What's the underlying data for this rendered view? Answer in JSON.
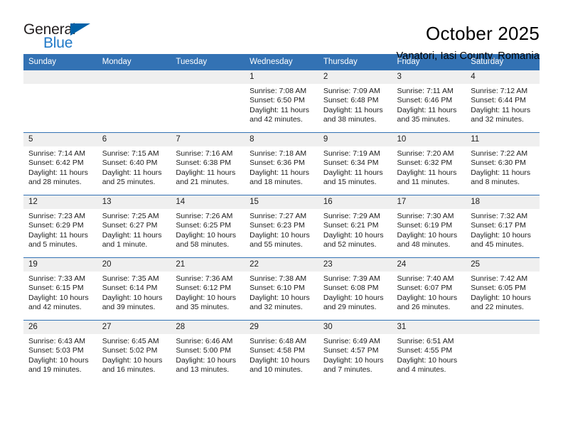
{
  "logo": {
    "word_top": "General",
    "word_bottom": "Blue",
    "triangle_color": "#0061a8",
    "blue_color": "#2079c7"
  },
  "header": {
    "month_title": "October 2025",
    "location": "Vanatori, Iasi County, Romania"
  },
  "theme": {
    "header_blue": "#3372b4",
    "daynum_band": "#efefef"
  },
  "weekday_headers": [
    "Sunday",
    "Monday",
    "Tuesday",
    "Wednesday",
    "Thursday",
    "Friday",
    "Saturday"
  ],
  "labels": {
    "sunrise_prefix": "Sunrise:",
    "sunset_prefix": "Sunset:",
    "daylight_prefix": "Daylight:"
  },
  "weeks": [
    [
      {
        "day": "",
        "blank": true
      },
      {
        "day": "",
        "blank": true
      },
      {
        "day": "",
        "blank": true
      },
      {
        "day": "1",
        "sunrise": "Sunrise: 7:08 AM",
        "sunset": "Sunset: 6:50 PM",
        "daylight": "Daylight: 11 hours and 42 minutes."
      },
      {
        "day": "2",
        "sunrise": "Sunrise: 7:09 AM",
        "sunset": "Sunset: 6:48 PM",
        "daylight": "Daylight: 11 hours and 38 minutes."
      },
      {
        "day": "3",
        "sunrise": "Sunrise: 7:11 AM",
        "sunset": "Sunset: 6:46 PM",
        "daylight": "Daylight: 11 hours and 35 minutes."
      },
      {
        "day": "4",
        "sunrise": "Sunrise: 7:12 AM",
        "sunset": "Sunset: 6:44 PM",
        "daylight": "Daylight: 11 hours and 32 minutes."
      }
    ],
    [
      {
        "day": "5",
        "sunrise": "Sunrise: 7:14 AM",
        "sunset": "Sunset: 6:42 PM",
        "daylight": "Daylight: 11 hours and 28 minutes."
      },
      {
        "day": "6",
        "sunrise": "Sunrise: 7:15 AM",
        "sunset": "Sunset: 6:40 PM",
        "daylight": "Daylight: 11 hours and 25 minutes."
      },
      {
        "day": "7",
        "sunrise": "Sunrise: 7:16 AM",
        "sunset": "Sunset: 6:38 PM",
        "daylight": "Daylight: 11 hours and 21 minutes."
      },
      {
        "day": "8",
        "sunrise": "Sunrise: 7:18 AM",
        "sunset": "Sunset: 6:36 PM",
        "daylight": "Daylight: 11 hours and 18 minutes."
      },
      {
        "day": "9",
        "sunrise": "Sunrise: 7:19 AM",
        "sunset": "Sunset: 6:34 PM",
        "daylight": "Daylight: 11 hours and 15 minutes."
      },
      {
        "day": "10",
        "sunrise": "Sunrise: 7:20 AM",
        "sunset": "Sunset: 6:32 PM",
        "daylight": "Daylight: 11 hours and 11 minutes."
      },
      {
        "day": "11",
        "sunrise": "Sunrise: 7:22 AM",
        "sunset": "Sunset: 6:30 PM",
        "daylight": "Daylight: 11 hours and 8 minutes."
      }
    ],
    [
      {
        "day": "12",
        "sunrise": "Sunrise: 7:23 AM",
        "sunset": "Sunset: 6:29 PM",
        "daylight": "Daylight: 11 hours and 5 minutes."
      },
      {
        "day": "13",
        "sunrise": "Sunrise: 7:25 AM",
        "sunset": "Sunset: 6:27 PM",
        "daylight": "Daylight: 11 hours and 1 minute."
      },
      {
        "day": "14",
        "sunrise": "Sunrise: 7:26 AM",
        "sunset": "Sunset: 6:25 PM",
        "daylight": "Daylight: 10 hours and 58 minutes."
      },
      {
        "day": "15",
        "sunrise": "Sunrise: 7:27 AM",
        "sunset": "Sunset: 6:23 PM",
        "daylight": "Daylight: 10 hours and 55 minutes."
      },
      {
        "day": "16",
        "sunrise": "Sunrise: 7:29 AM",
        "sunset": "Sunset: 6:21 PM",
        "daylight": "Daylight: 10 hours and 52 minutes."
      },
      {
        "day": "17",
        "sunrise": "Sunrise: 7:30 AM",
        "sunset": "Sunset: 6:19 PM",
        "daylight": "Daylight: 10 hours and 48 minutes."
      },
      {
        "day": "18",
        "sunrise": "Sunrise: 7:32 AM",
        "sunset": "Sunset: 6:17 PM",
        "daylight": "Daylight: 10 hours and 45 minutes."
      }
    ],
    [
      {
        "day": "19",
        "sunrise": "Sunrise: 7:33 AM",
        "sunset": "Sunset: 6:15 PM",
        "daylight": "Daylight: 10 hours and 42 minutes."
      },
      {
        "day": "20",
        "sunrise": "Sunrise: 7:35 AM",
        "sunset": "Sunset: 6:14 PM",
        "daylight": "Daylight: 10 hours and 39 minutes."
      },
      {
        "day": "21",
        "sunrise": "Sunrise: 7:36 AM",
        "sunset": "Sunset: 6:12 PM",
        "daylight": "Daylight: 10 hours and 35 minutes."
      },
      {
        "day": "22",
        "sunrise": "Sunrise: 7:38 AM",
        "sunset": "Sunset: 6:10 PM",
        "daylight": "Daylight: 10 hours and 32 minutes."
      },
      {
        "day": "23",
        "sunrise": "Sunrise: 7:39 AM",
        "sunset": "Sunset: 6:08 PM",
        "daylight": "Daylight: 10 hours and 29 minutes."
      },
      {
        "day": "24",
        "sunrise": "Sunrise: 7:40 AM",
        "sunset": "Sunset: 6:07 PM",
        "daylight": "Daylight: 10 hours and 26 minutes."
      },
      {
        "day": "25",
        "sunrise": "Sunrise: 7:42 AM",
        "sunset": "Sunset: 6:05 PM",
        "daylight": "Daylight: 10 hours and 22 minutes."
      }
    ],
    [
      {
        "day": "26",
        "sunrise": "Sunrise: 6:43 AM",
        "sunset": "Sunset: 5:03 PM",
        "daylight": "Daylight: 10 hours and 19 minutes."
      },
      {
        "day": "27",
        "sunrise": "Sunrise: 6:45 AM",
        "sunset": "Sunset: 5:02 PM",
        "daylight": "Daylight: 10 hours and 16 minutes."
      },
      {
        "day": "28",
        "sunrise": "Sunrise: 6:46 AM",
        "sunset": "Sunset: 5:00 PM",
        "daylight": "Daylight: 10 hours and 13 minutes."
      },
      {
        "day": "29",
        "sunrise": "Sunrise: 6:48 AM",
        "sunset": "Sunset: 4:58 PM",
        "daylight": "Daylight: 10 hours and 10 minutes."
      },
      {
        "day": "30",
        "sunrise": "Sunrise: 6:49 AM",
        "sunset": "Sunset: 4:57 PM",
        "daylight": "Daylight: 10 hours and 7 minutes."
      },
      {
        "day": "31",
        "sunrise": "Sunrise: 6:51 AM",
        "sunset": "Sunset: 4:55 PM",
        "daylight": "Daylight: 10 hours and 4 minutes."
      },
      {
        "day": "",
        "blank": true
      }
    ]
  ]
}
